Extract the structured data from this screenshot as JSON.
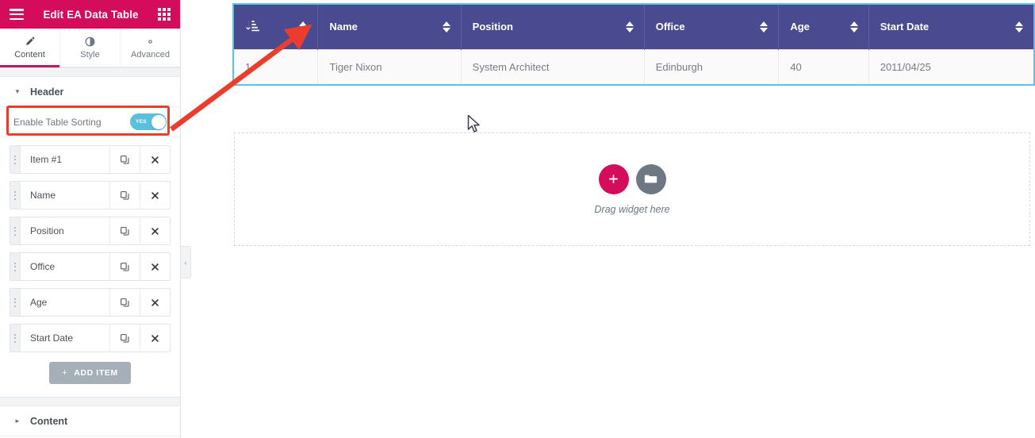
{
  "panel": {
    "title": "Edit EA Data Table",
    "menu_icon": "hamburger-icon",
    "grid_icon": "widgets-grid-icon",
    "tabs": [
      {
        "label": "Content",
        "icon": "pencil-icon",
        "active": true
      },
      {
        "label": "Style",
        "icon": "contrast-half-circle-icon",
        "active": false
      },
      {
        "label": "Advanced",
        "icon": "gear-icon",
        "active": false
      }
    ],
    "sections": [
      {
        "label": "Header",
        "expanded": true
      },
      {
        "label": "Content",
        "expanded": false
      }
    ],
    "controls": {
      "enable_table_sorting": {
        "label": "Enable Table Sorting",
        "value": "YES",
        "state": "on",
        "switch_color": "#5bc0de"
      }
    },
    "repeater": {
      "items": [
        {
          "title": "Item #1",
          "duplicate_icon": "clone-icon",
          "remove_icon": "close-x-icon"
        },
        {
          "title": "Name",
          "duplicate_icon": "clone-icon",
          "remove_icon": "close-x-icon"
        },
        {
          "title": "Position",
          "duplicate_icon": "clone-icon",
          "remove_icon": "close-x-icon"
        },
        {
          "title": "Office",
          "duplicate_icon": "clone-icon",
          "remove_icon": "close-x-icon"
        },
        {
          "title": "Age",
          "duplicate_icon": "clone-icon",
          "remove_icon": "close-x-icon"
        },
        {
          "title": "Start Date",
          "duplicate_icon": "clone-icon",
          "remove_icon": "close-x-icon"
        }
      ],
      "add_button": {
        "label": "ADD ITEM",
        "plus": "+"
      }
    }
  },
  "canvas": {
    "collapse_handle": "‹",
    "table": {
      "selected": true,
      "selection_color": "#59c3e3",
      "header_bg": "#4a4a91",
      "columns": [
        {
          "label": "",
          "icon": "sort-numeric-down-icon",
          "sortable": true
        },
        {
          "label": "Name",
          "sortable": true
        },
        {
          "label": "Position",
          "sortable": true
        },
        {
          "label": "Office",
          "sortable": true
        },
        {
          "label": "Age",
          "sortable": true
        },
        {
          "label": "Start Date",
          "sortable": true
        }
      ],
      "rows": [
        [
          "1",
          "Tiger Nixon",
          "System Architect",
          "Edinburgh",
          "40",
          "2011/04/25"
        ]
      ]
    },
    "dropzone": {
      "text": "Drag widget here",
      "add_icon": "plus-icon",
      "folder_icon": "folder-icon",
      "add_color": "#d30c5c",
      "folder_color": "#6d7882"
    }
  },
  "annotations": {
    "highlight_color": "#ec3c2d",
    "highlight_target": "enable-table-sorting-row",
    "arrow_from": "enable-table-sorting-toggle",
    "arrow_to": "column-sort-arrows"
  }
}
